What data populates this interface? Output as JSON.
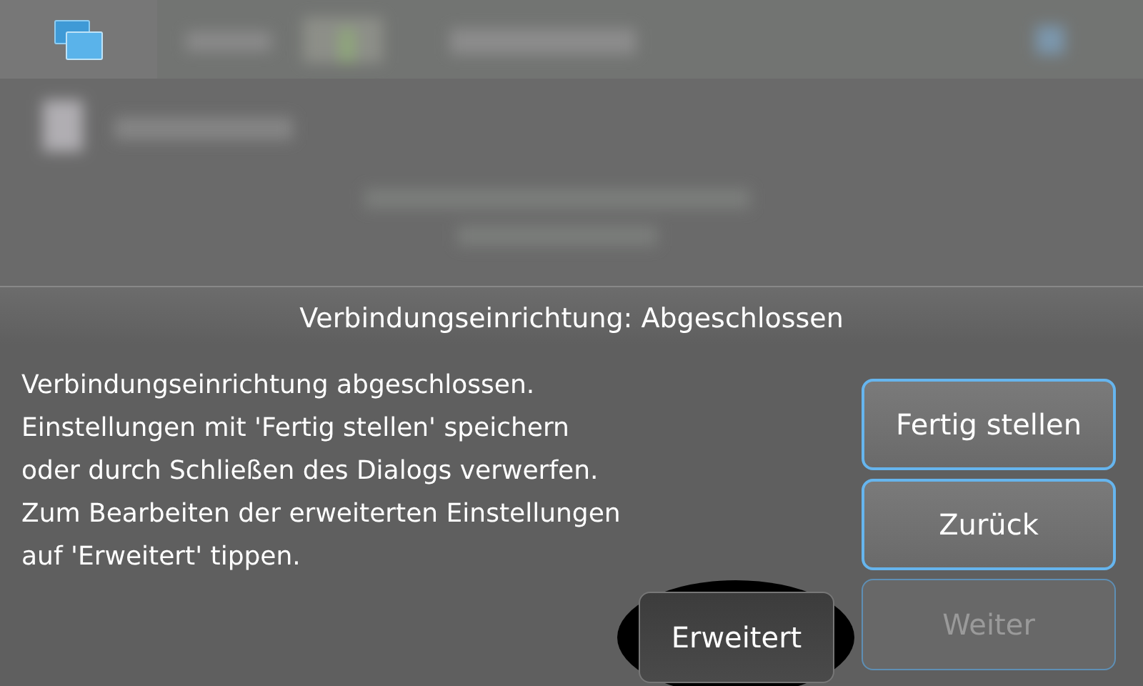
{
  "dialog": {
    "title": "Verbindungseinrichtung: Abgeschlossen",
    "message": [
      "Verbindungseinrichtung abgeschlossen.",
      "Einstellungen mit 'Fertig stellen' speichern",
      "oder durch Schließen des Dialogs verwerfen.",
      "Zum Bearbeiten der erweiterten Einstellungen",
      "auf 'Erweitert' tippen."
    ],
    "side_buttons": [
      {
        "label": "Fertig stellen",
        "disabled": false
      },
      {
        "label": "Zurück",
        "disabled": false
      },
      {
        "label": "Weiter",
        "disabled": true
      }
    ],
    "extra_button": {
      "label": "Erweitert",
      "highlighted": true
    }
  }
}
